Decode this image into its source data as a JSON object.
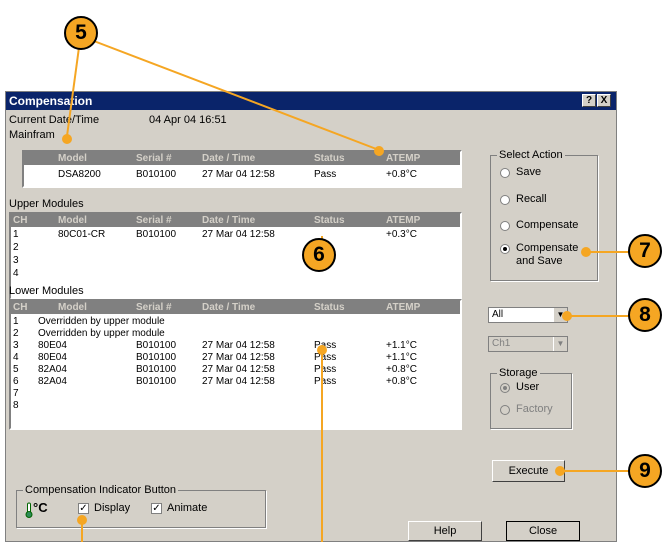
{
  "dialog": {
    "title": "Compensation",
    "help_btn": "?",
    "close_btn": "X",
    "current_datetime_label": "Current Date/Time",
    "current_datetime_value": "04 Apr 04 16:51",
    "mainframe_label": "Mainfram",
    "upper_label": "Upper Modules",
    "lower_label": "Lower Modules"
  },
  "mainframe": {
    "headers": [
      "Model",
      "Serial #",
      "Date / Time",
      "Status",
      "ATEMP"
    ],
    "row": {
      "model": "DSA8200",
      "serial": "B010100",
      "date": "27 Mar 04 12:58",
      "status": "Pass",
      "atemp": "+0.8°C"
    }
  },
  "upper": {
    "headers": [
      "CH",
      "Model",
      "Serial #",
      "Date / Time",
      "Status",
      "ATEMP"
    ],
    "rows": [
      {
        "ch": "1",
        "model": "80C01-CR",
        "serial": "B010100",
        "date": "27 Mar 04 12:58",
        "status": "",
        "atemp": "+0.3°C"
      },
      {
        "ch": "2",
        "model": "",
        "serial": "",
        "date": "",
        "status": "",
        "atemp": ""
      },
      {
        "ch": "3",
        "model": "",
        "serial": "",
        "date": "",
        "status": "",
        "atemp": ""
      },
      {
        "ch": "4",
        "model": "",
        "serial": "",
        "date": "",
        "status": "",
        "atemp": ""
      }
    ]
  },
  "lower": {
    "headers": [
      "CH",
      "Model",
      "Serial #",
      "Date / Time",
      "Status",
      "ATEMP"
    ],
    "rows": [
      {
        "ch": "1",
        "model": "Overridden by upper module",
        "serial": "",
        "date": "",
        "status": "",
        "atemp": ""
      },
      {
        "ch": "2",
        "model": "Overridden by upper module",
        "serial": "",
        "date": "",
        "status": "",
        "atemp": ""
      },
      {
        "ch": "3",
        "model": "80E04",
        "serial": "B010100",
        "date": "27 Mar 04 12:58",
        "status": "Pass",
        "atemp": "+1.1°C"
      },
      {
        "ch": "4",
        "model": "80E04",
        "serial": "B010100",
        "date": "27 Mar 04 12:58",
        "status": "Pass",
        "atemp": "+1.1°C"
      },
      {
        "ch": "5",
        "model": "82A04",
        "serial": "B010100",
        "date": "27 Mar 04 12:58",
        "status": "Pass",
        "atemp": "+0.8°C"
      },
      {
        "ch": "6",
        "model": "82A04",
        "serial": "B010100",
        "date": "27 Mar 04 12:58",
        "status": "Pass",
        "atemp": "+0.8°C"
      },
      {
        "ch": "7",
        "model": "",
        "serial": "",
        "date": "",
        "status": "",
        "atemp": ""
      },
      {
        "ch": "8",
        "model": "",
        "serial": "",
        "date": "",
        "status": "",
        "atemp": ""
      }
    ]
  },
  "select_action": {
    "title": "Select Action",
    "save": "Save",
    "recall": "Recall",
    "compensate": "Compensate",
    "compensate_save_1": "Compensate",
    "compensate_save_2": "and Save",
    "selected": "Compensate and Save"
  },
  "module_select": {
    "value": "All",
    "arrow": "▼"
  },
  "channel_select": {
    "value": "Ch1",
    "arrow": "▼"
  },
  "storage": {
    "title": "Storage",
    "user": "User",
    "factory": "Factory",
    "selected": "User"
  },
  "indicator": {
    "title": "Compensation Indicator Button",
    "icon_text": "°C",
    "display_label": "Display",
    "animate_label": "Animate",
    "display_checked": true,
    "animate_checked": true,
    "check_mark": "✓"
  },
  "buttons": {
    "execute": "Execute",
    "help": "Help",
    "close": "Close"
  },
  "callouts": [
    "5",
    "6",
    "7",
    "8",
    "9"
  ],
  "colors": {
    "callout": "#f5a623",
    "titlebar": "#0a246a",
    "dialog": "#d4d0c8"
  }
}
